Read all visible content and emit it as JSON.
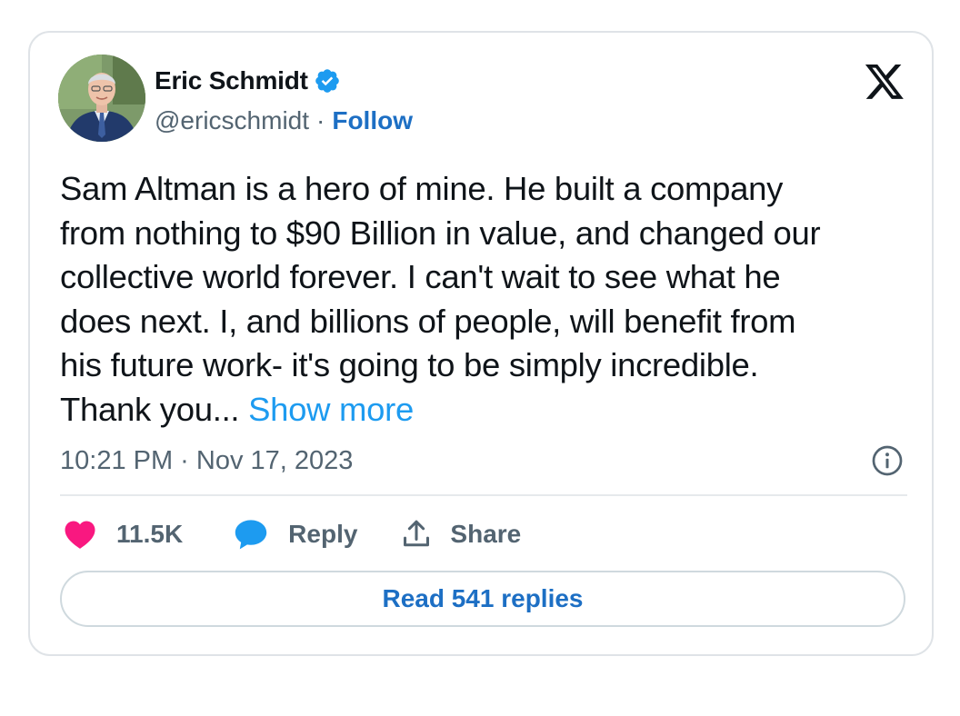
{
  "author": {
    "name": "Eric Schmidt",
    "handle": "@ericschmidt",
    "follow_label": "Follow",
    "verified": true,
    "verified_color": "#1d9bf0"
  },
  "tweet": {
    "lines": [
      "Sam Altman is a hero of mine.  He built a company",
      "from nothing to $90 Billion in value, and changed our",
      "collective world forever.  I can't wait to see what he",
      "does next.  I, and billions of people, will benefit from",
      "his future work- it's going to be simply incredible.",
      "Thank you... "
    ],
    "show_more_label": "Show more",
    "timestamp": "10:21 PM · Nov 17, 2023"
  },
  "actions": {
    "like_count": "11.5K",
    "like_color": "#f91880",
    "reply_label": "Reply",
    "reply_color": "#1d9bf0",
    "share_label": "Share"
  },
  "footer": {
    "read_replies_label": "Read 541 replies"
  },
  "icons": {
    "logo": "x-logo-icon",
    "verified": "verified-badge-icon",
    "info": "info-icon",
    "like": "heart-icon",
    "reply": "speech-bubble-icon",
    "share": "share-upload-icon"
  }
}
